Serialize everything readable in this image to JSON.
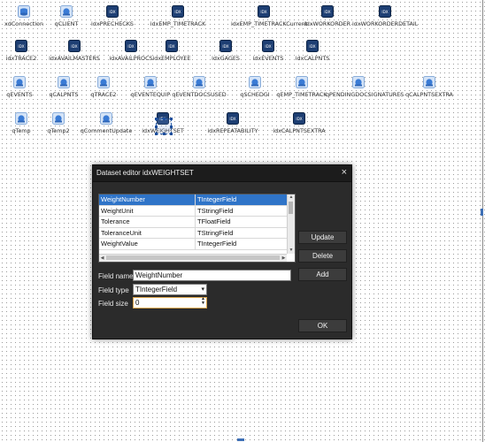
{
  "components": [
    {
      "name": "xdConnection",
      "kind": "conn"
    },
    {
      "name": "qCLIENT",
      "kind": "q"
    },
    {
      "name": "idxPRECHECKS",
      "kind": "idx"
    },
    {
      "name": "idxEMP_TIMETRACK",
      "kind": "idx"
    },
    {
      "name": "idxEMP_TIMETRACKCurrent",
      "kind": "idx"
    },
    {
      "name": "idxWORKORDER",
      "kind": "idx"
    },
    {
      "name": "idxWORKORDERDETAIL",
      "kind": "idx"
    },
    {
      "name": "idxTRACE2",
      "kind": "idx"
    },
    {
      "name": "idxAVAILMASTERS",
      "kind": "idx"
    },
    {
      "name": "idxAVAILPROCS",
      "kind": "idx"
    },
    {
      "name": "idxEMPLOYEE",
      "kind": "idx"
    },
    {
      "name": "idxGAGES",
      "kind": "idx"
    },
    {
      "name": "idxEVENTS",
      "kind": "idx"
    },
    {
      "name": "idxCALPNTS",
      "kind": "idx"
    },
    {
      "name": "qEVENTS",
      "kind": "q"
    },
    {
      "name": "qCALPNTS",
      "kind": "q"
    },
    {
      "name": "qTRACE2",
      "kind": "q"
    },
    {
      "name": "qEVENTEQUIP",
      "kind": "q"
    },
    {
      "name": "qEVENTDOCSUSED",
      "kind": "q"
    },
    {
      "name": "qSCHEDGI",
      "kind": "q"
    },
    {
      "name": "qEMP_TIMETRACK",
      "kind": "q"
    },
    {
      "name": "qPENDINGDOCSIGNATURES",
      "kind": "q"
    },
    {
      "name": "qCALPNTSEXTRA",
      "kind": "q"
    },
    {
      "name": "qTemp",
      "kind": "q"
    },
    {
      "name": "qTemp2",
      "kind": "q"
    },
    {
      "name": "qCommentUpdate",
      "kind": "q"
    },
    {
      "name": "idxWEIGHTSET",
      "kind": "idx"
    },
    {
      "name": "idxREPEATABILITY",
      "kind": "idx"
    },
    {
      "name": "idxCALPNTSEXTRA",
      "kind": "idx"
    }
  ],
  "icon_labels": {
    "idx": "IDX"
  },
  "dialog": {
    "title": "Dataset editor idxWEIGHTSET",
    "close": "×",
    "fields": [
      {
        "name": "WeightNumber",
        "type": "TIntegerField"
      },
      {
        "name": "WeightUnit",
        "type": "TStringField"
      },
      {
        "name": "Tolerance",
        "type": "TFloatField"
      },
      {
        "name": "ToleranceUnit",
        "type": "TStringField"
      },
      {
        "name": "WeightValue",
        "type": "TIntegerField"
      }
    ],
    "buttons": {
      "update": "Update",
      "delete": "Delete",
      "add": "Add",
      "ok": "OK"
    },
    "field_name_label": "Field name",
    "field_name_value": "WeightNumber",
    "field_type_label": "Field type",
    "field_type_value": "TIntegerField",
    "field_size_label": "Field size",
    "field_size_value": "0"
  },
  "colors": {
    "accent": "#2f74c8",
    "dialog_bg": "#2b2b2b",
    "icon_blue": "#3a7bd5",
    "icon_navy": "#1e3f73"
  }
}
